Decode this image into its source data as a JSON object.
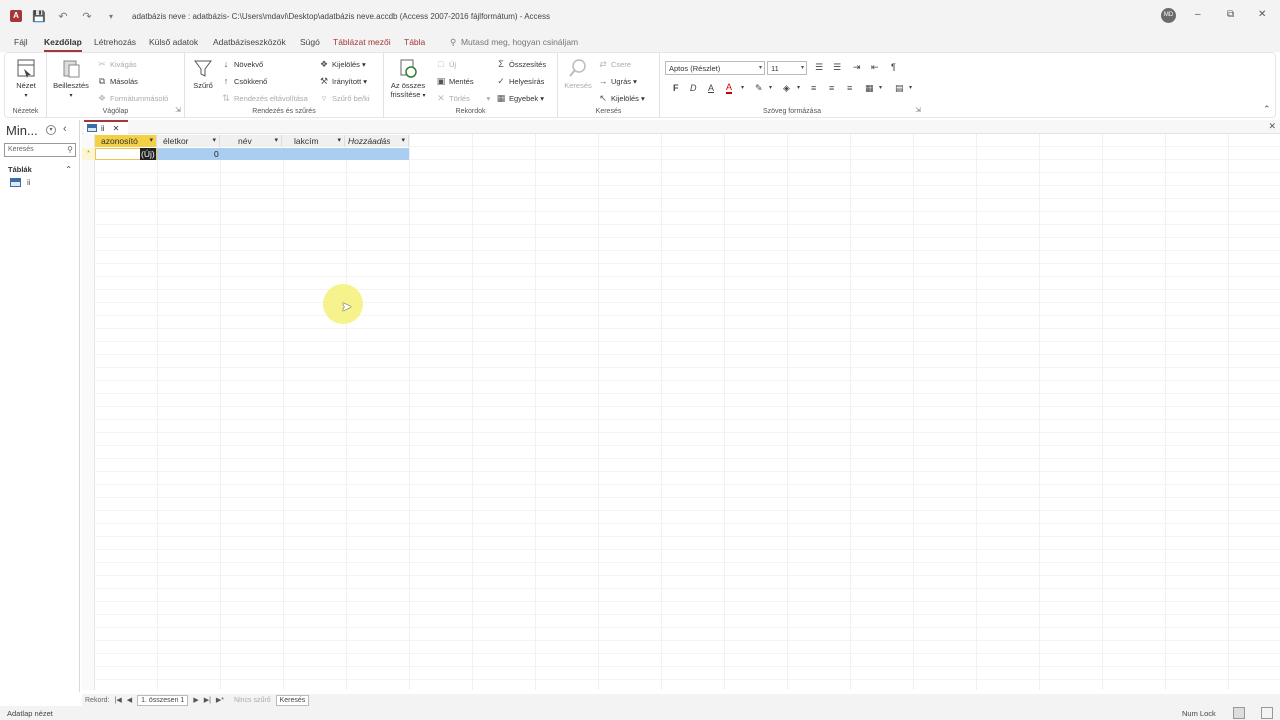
{
  "window": {
    "title": "adatbázis neve : adatbázis- C:\\Users\\mdavi\\Desktop\\adatbázis neve.accdb (Access 2007-2016 fájlformátum) - Access",
    "app_icon_label": "A",
    "user_initials": "MD",
    "controls": {
      "minimize": "–",
      "restore": "⧉",
      "close": "✕"
    }
  },
  "menu": {
    "tabs": [
      "Fájl",
      "Kezdőlap",
      "Létrehozás",
      "Külső adatok",
      "Adatbáziseszközök",
      "Súgó",
      "Táblázat mezői",
      "Tábla"
    ],
    "active": "Kezdőlap",
    "search_hint": "Mutasd meg, hogyan csináljam"
  },
  "ribbon": {
    "views": {
      "label": "Nézet",
      "group": "Nézetek"
    },
    "clipboard": {
      "paste": "Beillesztés",
      "cut": "Kivágás",
      "copy": "Másolás",
      "format_painter": "Formátummásoló",
      "group": "Vágólap"
    },
    "sort_filter": {
      "filter": "Szűrő",
      "ascending": "Növekvő",
      "descending": "Csökkenő",
      "remove_sort": "Rendezés eltávolítása",
      "selection": "Kijelölés",
      "advanced": "Irányított",
      "toggle_filter": "Szűrő be/ki",
      "group": "Rendezés és szűrés"
    },
    "records": {
      "refresh_line1": "Az összes",
      "refresh_line2": "frissítése",
      "new": "Új",
      "save": "Mentés",
      "delete": "Törlés",
      "totals": "Összesítés",
      "spelling": "Helyesírás",
      "more": "Egyebek",
      "group": "Rekordok"
    },
    "find": {
      "find": "Keresés",
      "replace": "Csere",
      "goto": "Ugrás",
      "select": "Kijelölés",
      "group": "Keresés"
    },
    "text_format": {
      "font": "Aptos (Részlet)",
      "size": "11",
      "bold": "F",
      "italic": "D",
      "underline": "A",
      "group": "Szöveg formázása"
    }
  },
  "nav_pane": {
    "title": "Min...",
    "search_placeholder": "Keresés",
    "group": "Táblák",
    "items": [
      "ii"
    ]
  },
  "document": {
    "tab_name": "ii",
    "columns": [
      "azonosító",
      "életkor",
      "név",
      "lakcím",
      "Hozzáadás"
    ],
    "new_row": {
      "id": "(Új)",
      "age": "0"
    },
    "new_row_marker": "*"
  },
  "record_nav": {
    "label": "Rekord:",
    "position": "1. összesen 1",
    "no_filter": "Nincs szűrő",
    "search": "Keresés"
  },
  "status": {
    "view": "Adatlap nézet",
    "numlock": "Num Lock"
  }
}
